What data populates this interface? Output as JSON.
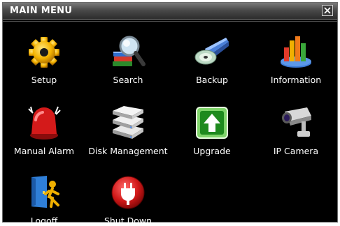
{
  "window": {
    "title": "MAIN MENU",
    "close_icon": "close-icon"
  },
  "menu": {
    "items": [
      {
        "label": "Setup",
        "icon": "gear-icon"
      },
      {
        "label": "Search",
        "icon": "magnifier-books-icon"
      },
      {
        "label": "Backup",
        "icon": "disc-drive-icon"
      },
      {
        "label": "Information",
        "icon": "bar-chart-icon"
      },
      {
        "label": "Manual Alarm",
        "icon": "alarm-siren-icon"
      },
      {
        "label": "Disk Management",
        "icon": "hard-disk-icon"
      },
      {
        "label": "Upgrade",
        "icon": "upgrade-arrow-icon"
      },
      {
        "label": "IP Camera",
        "icon": "ip-camera-icon"
      },
      {
        "label": "Logoff",
        "icon": "logoff-door-icon"
      },
      {
        "label": "Shut Down",
        "icon": "power-plug-icon"
      }
    ]
  }
}
